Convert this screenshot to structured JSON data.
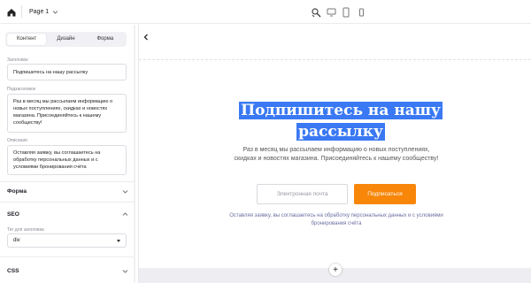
{
  "topbar": {
    "page_label": "Page 1",
    "icons": [
      "home-icon",
      "chevron-down-icon",
      "magic-brush-icon",
      "desktop-icon",
      "tablet-icon",
      "mobile-icon"
    ]
  },
  "sidebar": {
    "tabs": [
      {
        "label": "Контент",
        "active": true
      },
      {
        "label": "Дизайн",
        "active": false
      },
      {
        "label": "Форма",
        "active": false
      }
    ],
    "fields": {
      "title_label": "Заголовок",
      "title_value": "Подпишитесь на нашу рассылку",
      "subtitle_label": "Подзаголовок",
      "subtitle_value": "Раз в месяц мы рассылаем информацию о новых поступлениях, скидках и новостях магазина. Присоединяйтесь к нашему сообществу!",
      "description_label": "Описание",
      "description_value": "Оставляя заявку, вы соглашаетесь на обработку персональных данных и с условиями бронирования счёта"
    },
    "sections": {
      "form": "Форма",
      "seo": "SEO",
      "heading_tag_label": "Тег для заголовка",
      "heading_tag_value": "div",
      "css": "CSS"
    }
  },
  "preview": {
    "headline_line1": "Подпишитесь на нашу",
    "headline_line2": "рассылку",
    "description": "Раз в месяц мы рассылаем информацию о новых поступлениях, скидках и новостях магазина. Присоединяйтесь к нашему сообществу!",
    "email_placeholder": "Электронная почта",
    "subscribe_button": "Подписаться",
    "consent": "Оставляя заявку, вы соглашаетесь на обработку персональных данных и с условиями бронирования счёта",
    "add_block": "+"
  },
  "colors": {
    "accent_orange": "#f88609",
    "selection_blue": "#3a79f3",
    "consent_text": "#6c6ea1"
  }
}
